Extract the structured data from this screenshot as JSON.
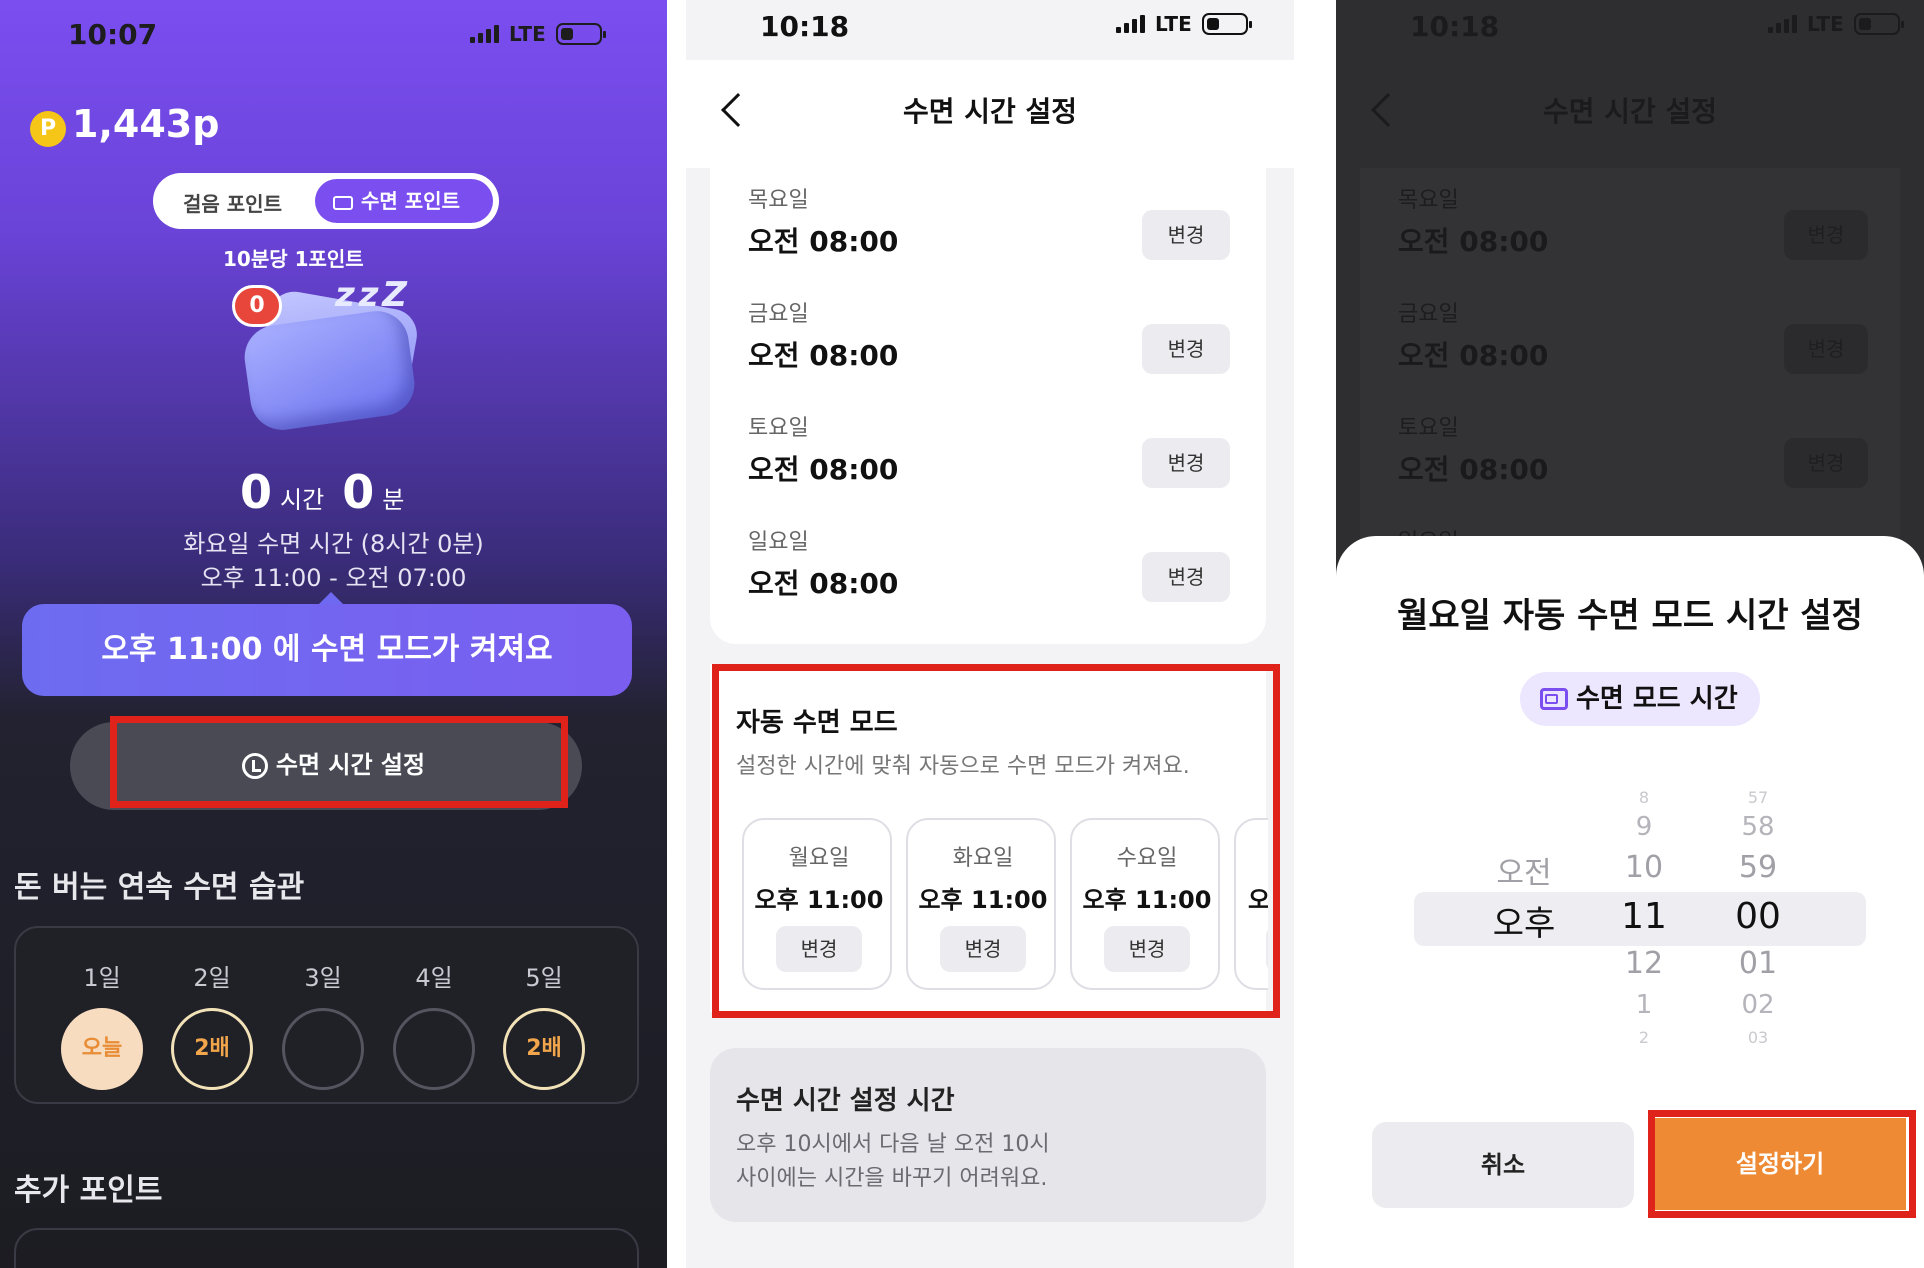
{
  "screen1": {
    "status_time": "10:07",
    "network": "LTE",
    "points": "1,443p",
    "coin_symbol": "P",
    "tabs": [
      "걸음 포인트",
      "수면 포인트"
    ],
    "rate": "10분당 1포인트",
    "badge": "0",
    "zzz": "z z Z",
    "hours_value": "0",
    "hours_unit": "시간",
    "minutes_value": "0",
    "minutes_unit": "분",
    "day_line": "화요일 수면 시간 (8시간 0분)",
    "range_line": "오후 11:00 - 오전 07:00",
    "banner": "오후 11:00 에 수면 모드가 켜져요",
    "sleep_button": "수면 시간 설정",
    "streak_title": "돈 버는 연속 수면 습관",
    "streak_days": [
      "1일",
      "2일",
      "3일",
      "4일",
      "5일"
    ],
    "streak_marks": [
      "오늘",
      "2배",
      "",
      "",
      "2배"
    ],
    "extra_title": "추가 포인트",
    "colors": {
      "purple": "#7b4ef0",
      "highlight_red": "#e0231a",
      "orange": "#ee8a33"
    }
  },
  "screen2": {
    "status_time": "10:18",
    "network": "LTE",
    "title": "수면 시간 설정",
    "rows": [
      {
        "day": "목요일",
        "time": "오전 08:00",
        "btn": "변경"
      },
      {
        "day": "금요일",
        "time": "오전 08:00",
        "btn": "변경"
      },
      {
        "day": "토요일",
        "time": "오전 08:00",
        "btn": "변경"
      },
      {
        "day": "일요일",
        "time": "오전 08:00",
        "btn": "변경"
      }
    ],
    "auto_title": "자동 수면 모드",
    "auto_desc": "설정한 시간에 맞춰 자동으로 수면 모드가 켜져요.",
    "auto_days": [
      {
        "day": "월요일",
        "time": "오후 11:00",
        "btn": "변경"
      },
      {
        "day": "화요일",
        "time": "오후 11:00",
        "btn": "변경"
      },
      {
        "day": "수요일",
        "time": "오후 11:00",
        "btn": "변경"
      },
      {
        "day": "",
        "time": "오",
        "btn": ""
      }
    ],
    "info_title": "수면 시간 설정 시간",
    "info_line1": "오후 10시에서 다음 날 오전 10시",
    "info_line2": "사이에는 시간을 바꾸기 어려워요."
  },
  "screen3": {
    "status_time": "10:18",
    "network": "LTE",
    "title": "수면 시간 설정",
    "rows": [
      {
        "day": "목요일",
        "time": "오전 08:00",
        "btn": "변경"
      },
      {
        "day": "금요일",
        "time": "오전 08:00",
        "btn": "변경"
      },
      {
        "day": "토요일",
        "time": "오전 08:00",
        "btn": "변경"
      }
    ],
    "partial_row": "일요일",
    "sheet_title": "월요일 자동 수면 모드 시간 설정",
    "chip": "수면 모드 시간",
    "picker": {
      "ampm": [
        "오전",
        "오후"
      ],
      "hours": [
        "8",
        "9",
        "10",
        "11",
        "12",
        "1",
        "2"
      ],
      "minutes": [
        "57",
        "58",
        "59",
        "00",
        "01",
        "02",
        "03"
      ],
      "selected": {
        "ampm": "오후",
        "hour": "11",
        "minute": "00"
      }
    },
    "cancel": "취소",
    "confirm": "설정하기"
  }
}
